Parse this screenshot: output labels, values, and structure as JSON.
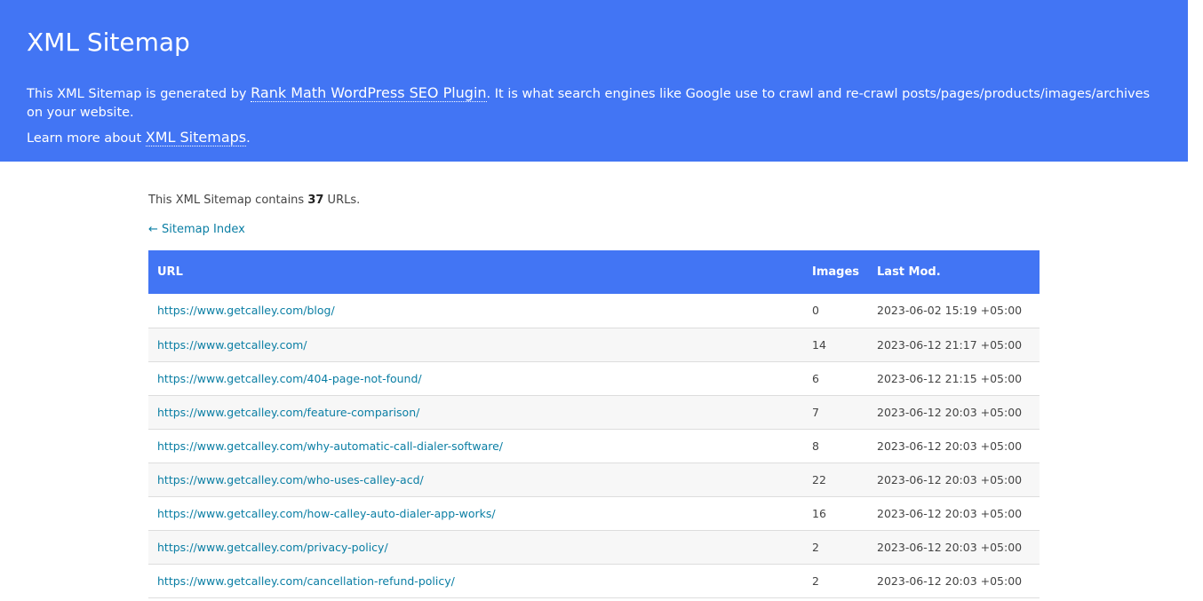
{
  "header": {
    "title": "XML Sitemap",
    "desc_prefix": "This XML Sitemap is generated by ",
    "plugin_link": "Rank Math WordPress SEO Plugin",
    "desc_suffix": ". It is what search engines like Google use to crawl and re-crawl posts/pages/products/images/archives on your website.",
    "learn_prefix": "Learn more about ",
    "learn_link": "XML Sitemaps",
    "learn_suffix": "."
  },
  "summary": {
    "prefix": "This XML Sitemap contains ",
    "count": "37",
    "suffix": " URLs."
  },
  "back_link": "← Sitemap Index",
  "table": {
    "headers": {
      "url": "URL",
      "images": "Images",
      "lastmod": "Last Mod."
    },
    "rows": [
      {
        "url": "https://www.getcalley.com/blog/",
        "images": "0",
        "lastmod": "2023-06-02 15:19 +05:00"
      },
      {
        "url": "https://www.getcalley.com/",
        "images": "14",
        "lastmod": "2023-06-12 21:17 +05:00"
      },
      {
        "url": "https://www.getcalley.com/404-page-not-found/",
        "images": "6",
        "lastmod": "2023-06-12 21:15 +05:00"
      },
      {
        "url": "https://www.getcalley.com/feature-comparison/",
        "images": "7",
        "lastmod": "2023-06-12 20:03 +05:00"
      },
      {
        "url": "https://www.getcalley.com/why-automatic-call-dialer-software/",
        "images": "8",
        "lastmod": "2023-06-12 20:03 +05:00"
      },
      {
        "url": "https://www.getcalley.com/who-uses-calley-acd/",
        "images": "22",
        "lastmod": "2023-06-12 20:03 +05:00"
      },
      {
        "url": "https://www.getcalley.com/how-calley-auto-dialer-app-works/",
        "images": "16",
        "lastmod": "2023-06-12 20:03 +05:00"
      },
      {
        "url": "https://www.getcalley.com/privacy-policy/",
        "images": "2",
        "lastmod": "2023-06-12 20:03 +05:00"
      },
      {
        "url": "https://www.getcalley.com/cancellation-refund-policy/",
        "images": "2",
        "lastmod": "2023-06-12 20:03 +05:00"
      }
    ]
  }
}
